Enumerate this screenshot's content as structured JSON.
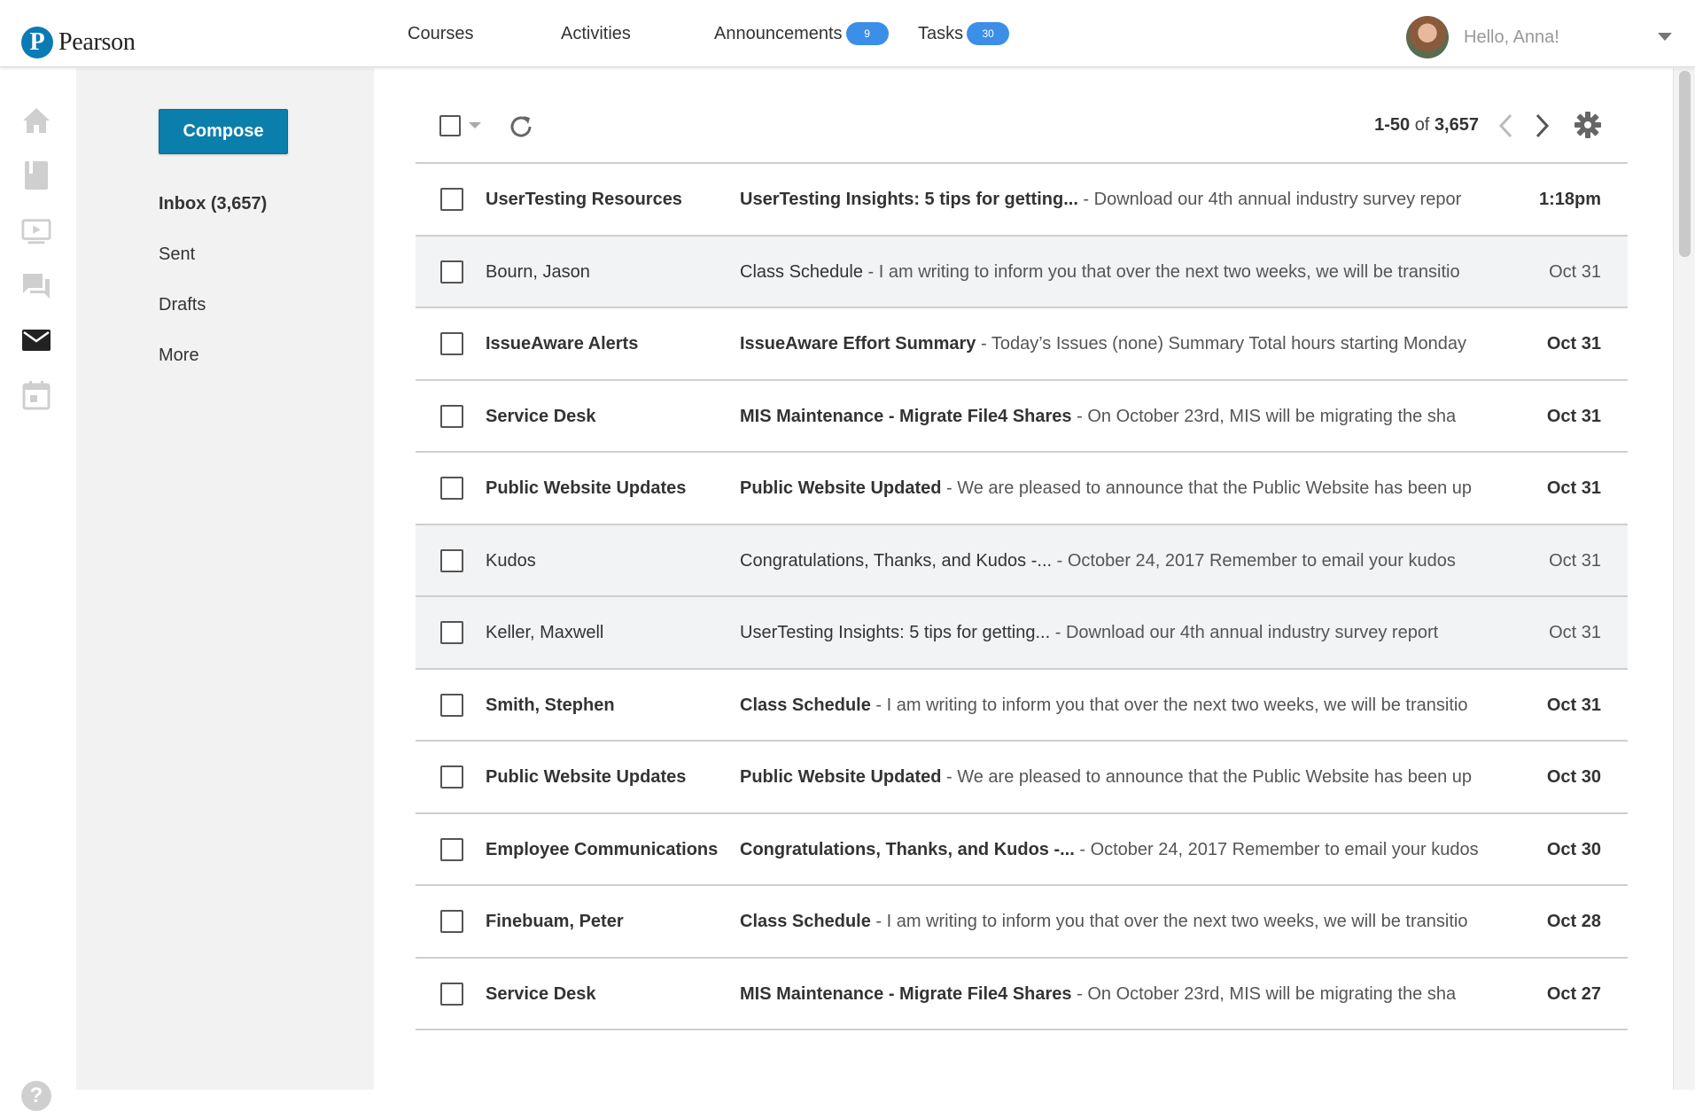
{
  "brand": {
    "name": "Pearson",
    "mark": "P"
  },
  "nav": {
    "courses": "Courses",
    "activities": "Activities",
    "announcements": "Announcements",
    "announcements_count": "9",
    "tasks": "Tasks",
    "tasks_count": "30"
  },
  "user": {
    "greeting": "Hello, Anna!"
  },
  "rail": [
    "home-icon",
    "book-icon",
    "video-icon",
    "chat-icon",
    "mail-icon",
    "calendar-icon",
    "help-icon"
  ],
  "folders": {
    "compose": "Compose",
    "inbox": "Inbox (3,657)",
    "sent": "Sent",
    "drafts": "Drafts",
    "more": "More"
  },
  "toolbar": {
    "range": "1-50",
    "of": "of",
    "total": "3,657"
  },
  "messages": [
    {
      "sender": "UserTesting Resources",
      "subject": "UserTesting Insights: 5 tips for getting...",
      "preview": " - Download our 4th annual industry survey repor",
      "date": "1:18pm",
      "unread": true
    },
    {
      "sender": "Bourn, Jason",
      "subject": "Class Schedule",
      "preview": " - I am writing to inform you that over the next two weeks, we will be transitio",
      "date": "Oct 31",
      "unread": false
    },
    {
      "sender": "IssueAware Alerts",
      "subject": "IssueAware Effort Summary",
      "preview": " - Today’s Issues (none) Summary Total hours starting Monday",
      "date": "Oct 31",
      "unread": true
    },
    {
      "sender": "Service Desk",
      "subject": "MIS Maintenance - Migrate File4 Shares",
      "preview": " - On October 23rd, MIS will be migrating the sha",
      "date": "Oct 31",
      "unread": true
    },
    {
      "sender": "Public Website Updates",
      "subject": "Public Website Updated",
      "preview": " - We are pleased to announce that the Public Website has been up",
      "date": "Oct 31",
      "unread": true
    },
    {
      "sender": "Kudos",
      "subject": "Congratulations, Thanks, and Kudos -...",
      "preview": " - October 24, 2017 Remember to email your kudos",
      "date": "Oct 31",
      "unread": false
    },
    {
      "sender": "Keller, Maxwell",
      "subject": "UserTesting Insights: 5 tips for getting...",
      "preview": " - Download our 4th annual industry survey report",
      "date": "Oct 31",
      "unread": false
    },
    {
      "sender": "Smith, Stephen",
      "subject": "Class Schedule",
      "preview": " - I am writing to inform you that over the next two weeks, we will be transitio",
      "date": "Oct 31",
      "unread": true
    },
    {
      "sender": "Public Website Updates",
      "subject": "Public Website Updated",
      "preview": " - We are pleased to announce that the Public Website has been up",
      "date": "Oct 30",
      "unread": true
    },
    {
      "sender": "Employee Communications",
      "subject": "Congratulations, Thanks, and Kudos -...",
      "preview": " - October 24, 2017 Remember to email your kudos",
      "date": "Oct 30",
      "unread": true
    },
    {
      "sender": "Finebuam, Peter",
      "subject": "Class Schedule",
      "preview": " - I am writing to inform you that over the next two weeks, we will be transitio",
      "date": "Oct 28",
      "unread": true
    },
    {
      "sender": "Service Desk",
      "subject": "MIS Maintenance - Migrate File4 Shares",
      "preview": " - On October 23rd, MIS will be migrating the sha",
      "date": "Oct 27",
      "unread": true
    }
  ],
  "colors": {
    "accent": "#0b7fab",
    "badge": "#3b8fe8",
    "read_row": "#f2f3f5",
    "rail_icon": "#cfcfcf",
    "active_icon": "#222222"
  }
}
